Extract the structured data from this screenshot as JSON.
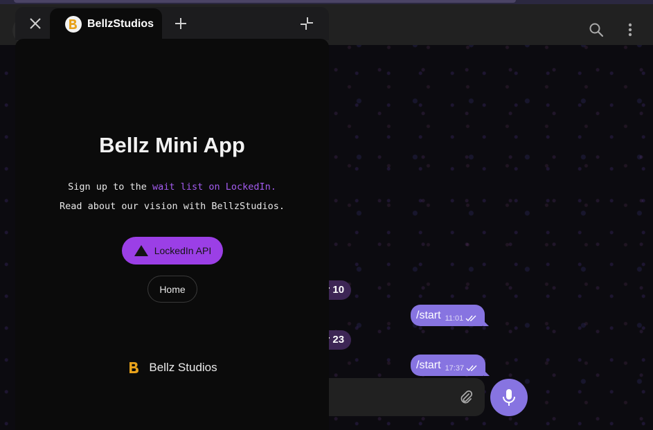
{
  "mini_app": {
    "tab_title": "BellzStudios",
    "title": "Bellz Mini App",
    "line1_prefix": "Sign up to the ",
    "line1_link": "wait list on LockedIn.",
    "line2": "Read about our vision with BellzStudios.",
    "primary_button": "LockedIn API",
    "secondary_button": "Home",
    "footer": "Bellz Studios"
  },
  "chat": {
    "date_pills": [
      "er 10",
      "er 23"
    ],
    "messages": [
      {
        "text": "/start",
        "time": "11:01"
      },
      {
        "text": "/start",
        "time": "17:37"
      }
    ]
  },
  "colors": {
    "accent": "#8774e1",
    "mini_app_button": "#9b3fe6",
    "link": "#a45cf0",
    "logo_gold": "#e8a21b"
  },
  "icons": [
    "close-icon",
    "plus-icon",
    "collapse-icon",
    "search-icon",
    "more-vertical-icon",
    "paperclip-icon",
    "microphone-icon",
    "triangle-icon",
    "bellz-logo-icon",
    "double-check-icon"
  ]
}
